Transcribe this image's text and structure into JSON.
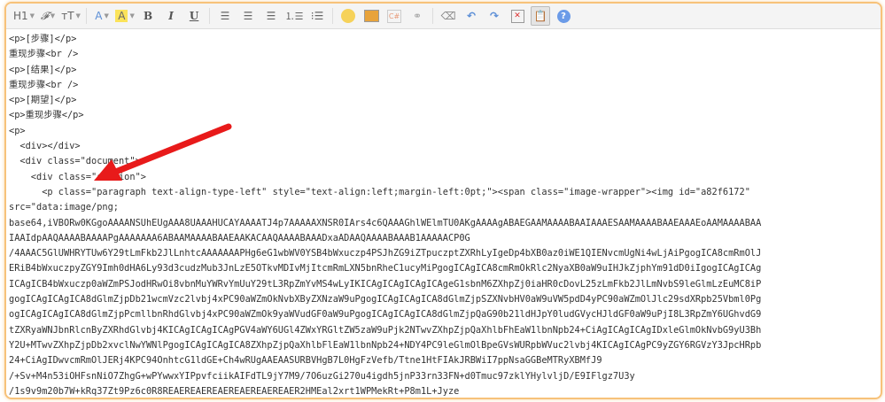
{
  "toolbar": {
    "heading": "H1",
    "font_family": "𝓕",
    "font_size": "тT",
    "font_color": "A",
    "highlight": "A",
    "bold": "B",
    "italic": "I",
    "underline": "U",
    "active_button": "source-code"
  },
  "code_lines": [
    "<p>[步骤]</p>",
    "重现步骤<br />",
    "<p>[结果]</p>",
    "重现步骤<br />",
    "<p>[期望]</p>",
    "<p>重现步骤</p>",
    "<p>",
    "  <div></div>",
    "  <div class=\"document\">",
    "    <div class=\"section\">",
    "      <p class=\"paragraph text-align-type-left\" style=\"text-align:left;margin-left:0pt;\"><span class=\"image-wrapper\"><img id=\"a82f6172\"",
    "src=\"data:image/png;",
    "base64,iVBORw0KGgoAAAANSUhEUgAAA8UAAAHUCAYAAAATJ4p7AAAAAXNSR0IArs4c6QAAAGhlWElmTU0AKgAAAAgABAEGAAMAAAABAAIAAAESAAMAAAABAAEAAAEoAAMAAAABAA",
    "IAAIdpAAQAAAABAAAAPgAAAAAAA6ABAAMAAAABAAEAAKACAAQAAAABAAADxaADAAQAAAABAAAB1AAAAACP0G",
    "/4AAAC5GlUWHRYTUw6Y29tLmFkb2JlLnhtcAAAAAAAPHg6eG1wbWV0YSB4bWxuczp4PSJhZG9iZTpuczptZXRhLyIgeDp4bXB0az0iWE1QIENvcmUgNi4wLjAiPgogICA8cmRmOlJ",
    "ERiB4bWxuczpyZGY9Imh0dHA6Ly93d3cudzMub3JnLzE5OTkvMDIvMjItcmRmLXN5bnRheC1ucyMiPgogICAgICA8cmRmOkRlc2NyaXB0aW9uIHJkZjphYm91dD0iIgogICAgICAg",
    "ICAgICB4bWxuczp0aWZmPSJodHRwOi8vbnMuYWRvYmUuY29tL3RpZmYvMS4wLyIKICAgICAgICAgICAgeG1sbnM6ZXhpZj0iaHR0cDovL25zLmFkb2JlLmNvbS9leGlmLzEuMC8iP",
    "gogICAgICAgICA8dGlmZjpDb21wcmVzc2lvbj4xPC90aWZmOkNvbXByZXNzaW9uPgogICAgICAgICA8dGlmZjpSZXNvbHV0aW9uVW5pdD4yPC90aWZmOlJlc29sdXRpb25Vbml0Pg",
    "ogICAgICAgICA8dGlmZjpPcmllbnRhdGlvbj4xPC90aWZmOk9yaWVudGF0aW9uPgogICAgICAgICA8dGlmZjpQaG90b21ldHJpY0ludGVycHJldGF0aW9uPjI8L3RpZmY6UGhvdG9",
    "tZXRyaWNJbnRlcnByZXRhdGlvbj4KICAgICAgICAgPGV4aWY6UGl4ZWxYRGltZW5zaW9uPjk2NTwvZXhpZjpQaXhlbFhEaW1lbnNpb24+CiAgICAgICAgIDxleGlmOkNvbG9yU3Bh",
    "Y2U+MTwvZXhpZjpDb2xvclNwYWNlPgogICAgICAgICA8ZXhpZjpQaXhlbFlEaW1lbnNpb24+NDY4PC9leGlmOlBpeGVsWURpbWVuc2lvbj4KICAgICAgPC9yZGY6RGVzY3JpcHRpb",
    "24+CiAgIDwvcmRmOlJERj4KPC94OnhtcG1ldGE+Ch4wRUgAAEAASURBVHgB7L0HgFzVefb/Ttne1HtFIAkJRBWiI7ppNsaGGBeMTRyXBMfJ9",
    "/+Sv+M4n53iOHFsnNiO7ZhgG+wPYwwxYIPpvfciikAIFdTL9jY7M9/7O6uzGi270u4igdh5jnP33rn33FN+d0Tmuc97zklYHylvljD/E9IFlgz7U3y",
    "/1s9v9m20b7W+kRq37Zt9Pz6c0R8REAEREAEREAEREAEREAEREAER2HMEal2xrt1WPMekRt+P8m1L+Jyze"
  ],
  "colors": {
    "border": "#f7c27a",
    "arrow": "#e81a1a",
    "toolbar_bg": "#f4f4f4"
  }
}
